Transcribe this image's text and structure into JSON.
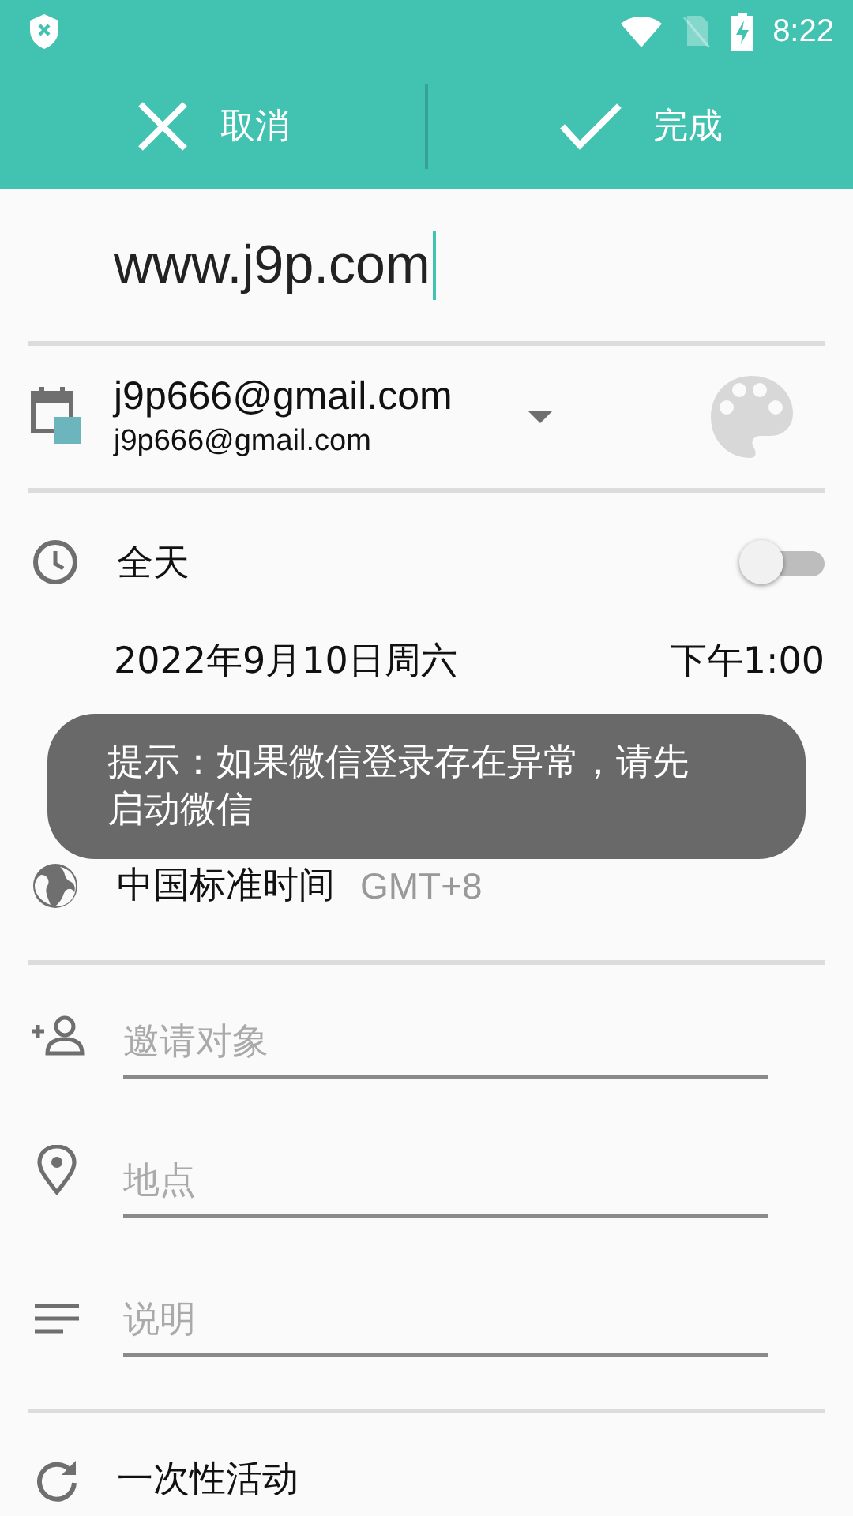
{
  "status_bar": {
    "time": "8:22"
  },
  "toolbar": {
    "cancel": "取消",
    "done": "完成"
  },
  "title_field": {
    "value": "www.j9p.com"
  },
  "account": {
    "name": "j9p666@gmail.com",
    "email": "j9p666@gmail.com",
    "color": "#6db5bd"
  },
  "all_day": {
    "label": "全天",
    "on": false
  },
  "start": {
    "date": "2022年9月10日周六",
    "time": "下午1:00"
  },
  "toast": {
    "text": "提示：如果微信登录存在异常，请先启动微信"
  },
  "timezone": {
    "name": "中国标准时间",
    "offset": "GMT+8"
  },
  "fields": [
    {
      "kind": "guests",
      "placeholder": "邀请对象"
    },
    {
      "kind": "location",
      "placeholder": "地点"
    },
    {
      "kind": "description",
      "placeholder": "说明"
    }
  ],
  "repeat": {
    "label": "一次性活动"
  }
}
